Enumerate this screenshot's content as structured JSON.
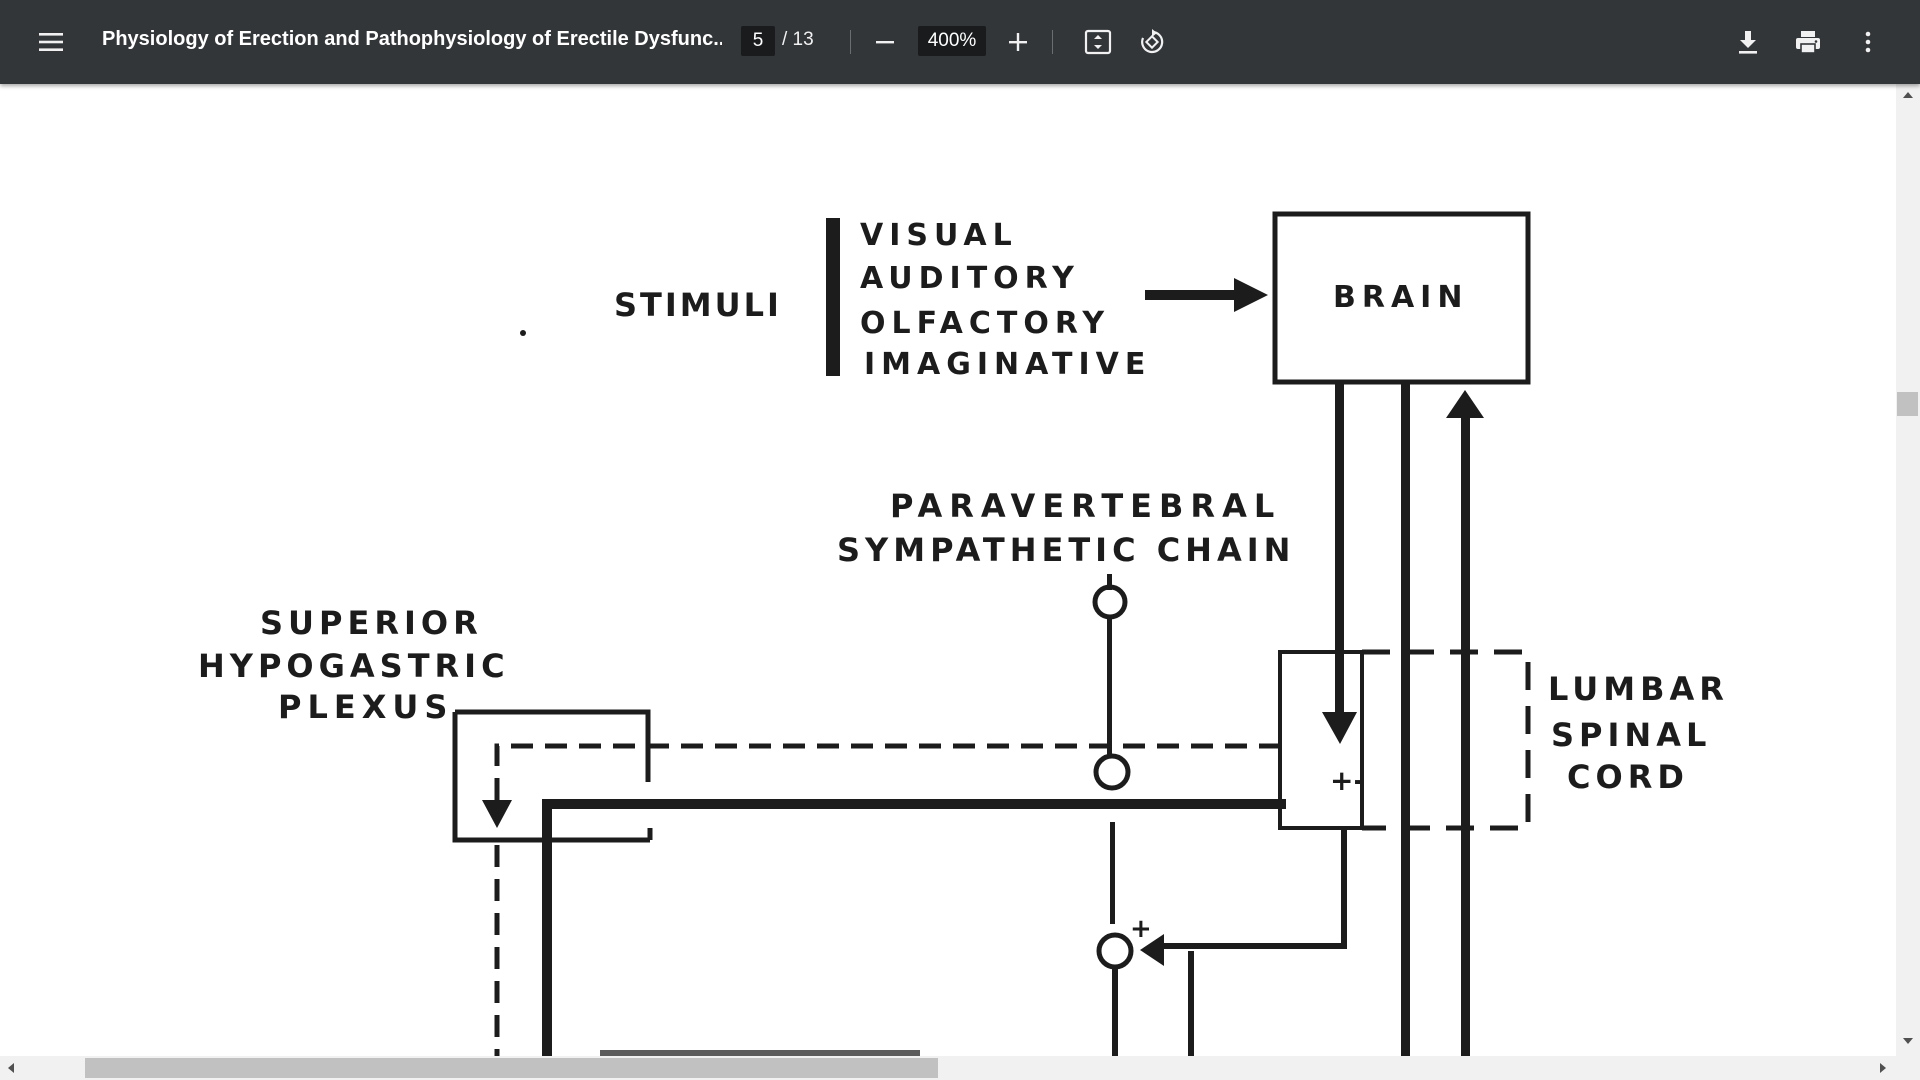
{
  "toolbar": {
    "title": "Physiology of Erection and Pathophysiology of Erectile Dysfunc...",
    "page_current": "5",
    "page_total": "/ 13",
    "zoom": "400%",
    "icons": {
      "menu": "menu-icon",
      "zoom_out": "minus-icon",
      "zoom_in": "plus-icon",
      "fit": "fit-page-icon",
      "rotate": "rotate-icon",
      "download": "download-icon",
      "print": "print-icon",
      "more": "more-vert-icon"
    },
    "colors": {
      "bar": "#323639",
      "input": "#191b1c",
      "text": "#f1f1f1"
    }
  },
  "diagram": {
    "stimuli": "STIMULI",
    "stimuli_list": [
      "VISUAL",
      "AUDITORY",
      "OLFACTORY",
      "IMAGINATIVE"
    ],
    "brain": "BRAIN",
    "paravertebral": "PARAVERTEBRAL",
    "sympathetic_chain": "SYMPATHETIC CHAIN",
    "superior": "SUPERIOR",
    "hypogastric": "HYPOGASTRIC",
    "plexus": "PLEXUS",
    "lumbar": "LUMBAR",
    "spinal": "SPINAL",
    "cord": "CORD",
    "polarity": "+-",
    "excite": "+"
  }
}
